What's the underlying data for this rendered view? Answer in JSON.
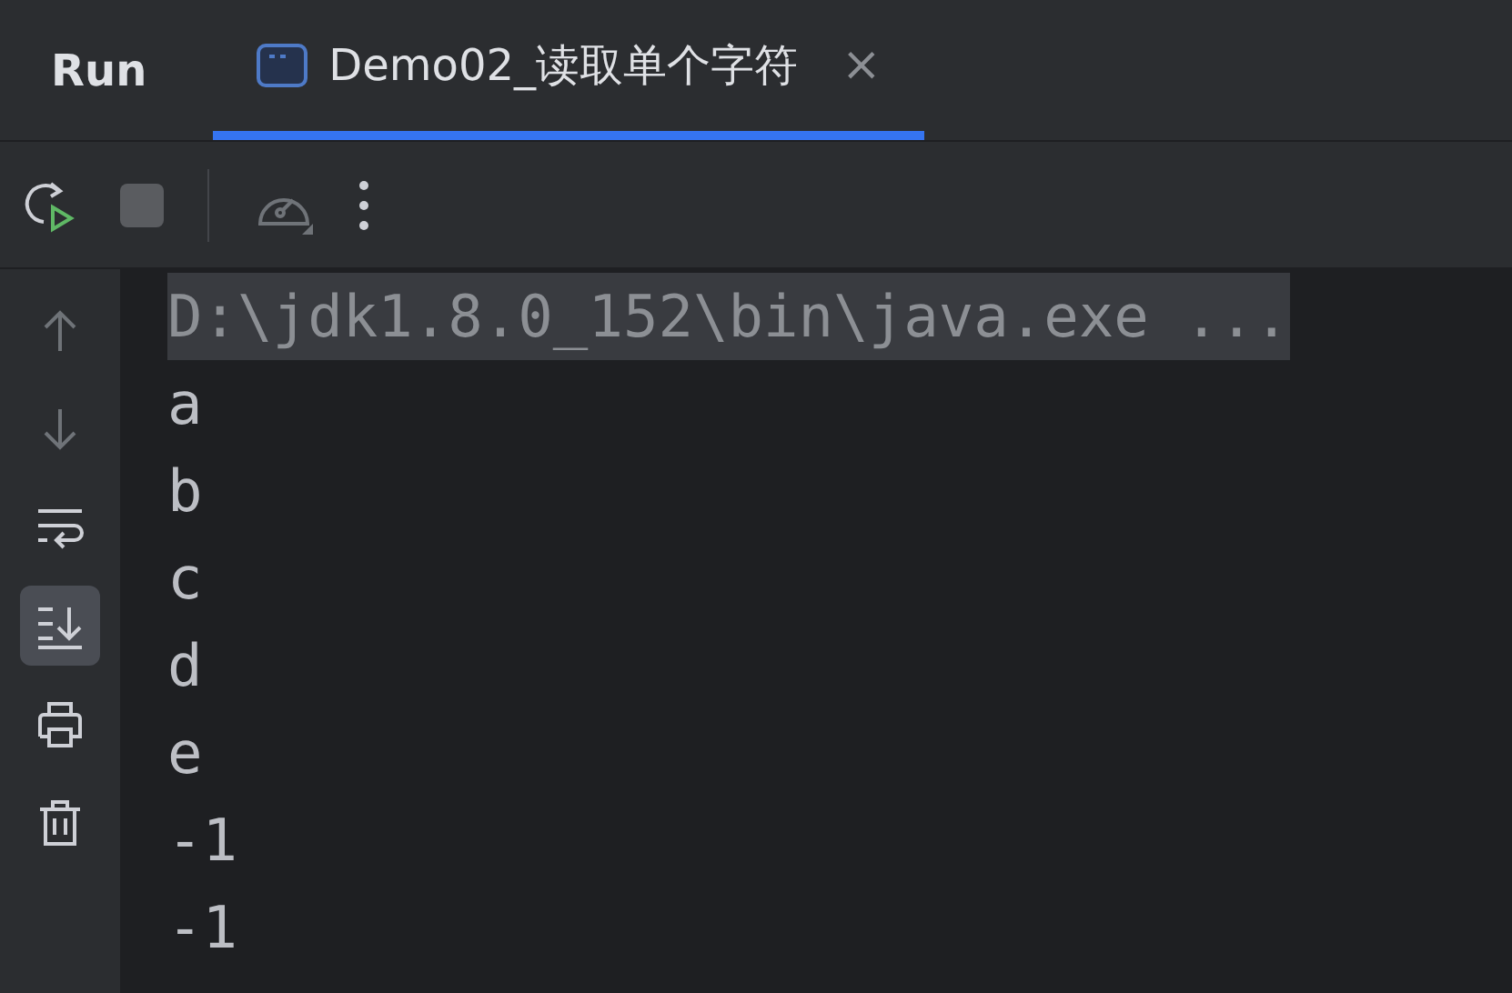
{
  "header": {
    "title": "Run",
    "tabs": [
      {
        "label": "Demo02_读取单个字符",
        "selected": true,
        "close": "×"
      }
    ]
  },
  "toolbar": [
    {
      "kind": "rerun",
      "disabled": false
    },
    {
      "kind": "stop",
      "disabled": true
    },
    {
      "kind": "separator"
    },
    {
      "kind": "profiler",
      "disabled": true
    },
    {
      "kind": "more",
      "disabled": false
    }
  ],
  "sidebar": [
    {
      "kind": "up",
      "disabled": true,
      "selected": false
    },
    {
      "kind": "down",
      "disabled": true,
      "selected": false
    },
    {
      "kind": "wrap",
      "disabled": false,
      "selected": false
    },
    {
      "kind": "scroll-end",
      "disabled": false,
      "selected": true
    },
    {
      "kind": "print",
      "disabled": false,
      "selected": false
    },
    {
      "kind": "trash",
      "disabled": false,
      "selected": false
    }
  ],
  "console": [
    {
      "kind": "command",
      "text": "D:\\jdk1.8.0_152\\bin\\java.exe ..."
    },
    {
      "kind": "output",
      "text": "a"
    },
    {
      "kind": "output",
      "text": "b"
    },
    {
      "kind": "output",
      "text": "c"
    },
    {
      "kind": "output",
      "text": "d"
    },
    {
      "kind": "output",
      "text": "e"
    },
    {
      "kind": "output",
      "text": "-1"
    },
    {
      "kind": "output",
      "text": "-1"
    }
  ]
}
